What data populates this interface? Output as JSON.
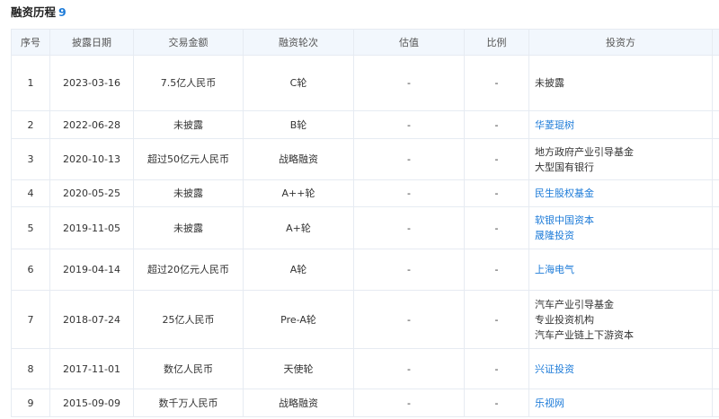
{
  "section": {
    "title": "融资历程",
    "count": "9"
  },
  "columns": [
    "序号",
    "披露日期",
    "交易金额",
    "融资轮次",
    "估值",
    "比例",
    "投资方"
  ],
  "rows": [
    {
      "no": "1",
      "date": "2023-03-16",
      "amount": "7.5亿人民币",
      "round": "C轮",
      "valuation": "-",
      "ratio": "-",
      "investors": [
        {
          "name": "未披露",
          "link": false
        }
      ]
    },
    {
      "no": "2",
      "date": "2022-06-28",
      "amount": "未披露",
      "round": "B轮",
      "valuation": "-",
      "ratio": "-",
      "investors": [
        {
          "name": "华菱琨树",
          "link": true
        }
      ]
    },
    {
      "no": "3",
      "date": "2020-10-13",
      "amount": "超过50亿元人民币",
      "round": "战略融资",
      "valuation": "-",
      "ratio": "-",
      "investors": [
        {
          "name": "地方政府产业引导基金",
          "link": false
        },
        {
          "name": "大型国有银行",
          "link": false
        }
      ]
    },
    {
      "no": "4",
      "date": "2020-05-25",
      "amount": "未披露",
      "round": "A++轮",
      "valuation": "-",
      "ratio": "-",
      "investors": [
        {
          "name": "民生股权基金",
          "link": true
        }
      ]
    },
    {
      "no": "5",
      "date": "2019-11-05",
      "amount": "未披露",
      "round": "A+轮",
      "valuation": "-",
      "ratio": "-",
      "investors": [
        {
          "name": "软银中国资本",
          "link": true
        },
        {
          "name": "晟隆投资",
          "link": true
        }
      ]
    },
    {
      "no": "6",
      "date": "2019-04-14",
      "amount": "超过20亿元人民币",
      "round": "A轮",
      "valuation": "-",
      "ratio": "-",
      "investors": [
        {
          "name": "上海电气",
          "link": true
        }
      ]
    },
    {
      "no": "7",
      "date": "2018-07-24",
      "amount": "25亿人民币",
      "round": "Pre-A轮",
      "valuation": "-",
      "ratio": "-",
      "investors": [
        {
          "name": "汽车产业引导基金",
          "link": false
        },
        {
          "name": "专业投资机构",
          "link": false
        },
        {
          "name": "汽车产业链上下游资本",
          "link": false
        }
      ]
    },
    {
      "no": "8",
      "date": "2017-11-01",
      "amount": "数亿人民币",
      "round": "天使轮",
      "valuation": "-",
      "ratio": "-",
      "investors": [
        {
          "name": "兴证投资",
          "link": true
        }
      ]
    },
    {
      "no": "9",
      "date": "2015-09-09",
      "amount": "数千万人民币",
      "round": "战略融资",
      "valuation": "-",
      "ratio": "-",
      "investors": [
        {
          "name": "乐视网",
          "link": true
        }
      ]
    }
  ]
}
